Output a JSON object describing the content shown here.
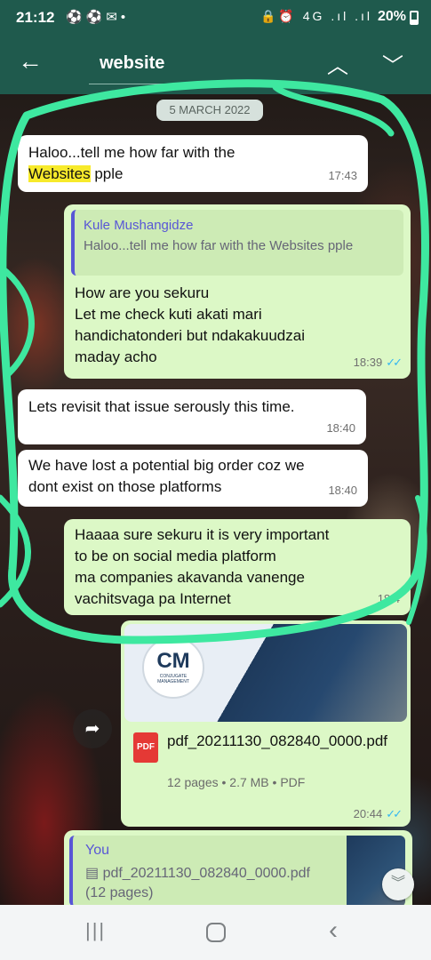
{
  "status": {
    "time": "21:12",
    "left_icons": "⚽⚽✉•",
    "right_icons": "🔒⏰ 4G .ıl .ıl",
    "battery": "20%"
  },
  "search": {
    "query": "website",
    "back_icon": "arrow-left-icon",
    "up_icon": "chevron-up-icon",
    "down_icon": "chevron-down-icon"
  },
  "chat": {
    "date_chip": "5 MARCH 2022",
    "messages": [
      {
        "type": "in",
        "text_before": "Haloo...tell me how far with the",
        "highlight": "Websites",
        "text_after": " pple",
        "time": "17:43"
      },
      {
        "type": "out",
        "quote_name": "Kule Mushangidze",
        "quote_text": "Haloo...tell me how far with the Websites pple",
        "lines": [
          "How are you sekuru",
          "Let me check kuti akati mari",
          "handichatonderi but ndakakuudzai",
          "maday acho"
        ],
        "time": "18:39"
      },
      {
        "type": "in",
        "text": "Lets revisit that issue serously  this time.",
        "time": "18:40"
      },
      {
        "type": "in",
        "lines": [
          "We have lost a potential big order coz we",
          "dont exist on those platforms"
        ],
        "time": "18:40"
      },
      {
        "type": "out",
        "lines": [
          "Haaaa sure sekuru it is very important",
          "to be on social media platform",
          "ma companies akavanda vanenge",
          "vachitsvaga pa Internet"
        ],
        "time": "18:4"
      }
    ],
    "document": {
      "logo_mark": "CM",
      "logo_sub": "CONJUGATE MANAGEMENT",
      "badge": "PDF",
      "filename": "pdf_20211130_082840_0000.pdf",
      "info": "12 pages • 2.7 MB • PDF",
      "time": "20:44"
    },
    "reply": {
      "author": "You",
      "file": "pdf_20211130_082840_0000.pdf",
      "pages": "(12 pages)"
    }
  },
  "colors": {
    "header": "#1f5a4d",
    "incoming": "#ffffff",
    "outgoing": "#dcf8c6",
    "highlight": "#f7ea2b",
    "annotation": "#3ee8a0",
    "read_ticks": "#34b7f1"
  },
  "nav": {
    "recents_icon": "recents-icon",
    "home_icon": "home-icon",
    "back_icon": "back-icon"
  }
}
